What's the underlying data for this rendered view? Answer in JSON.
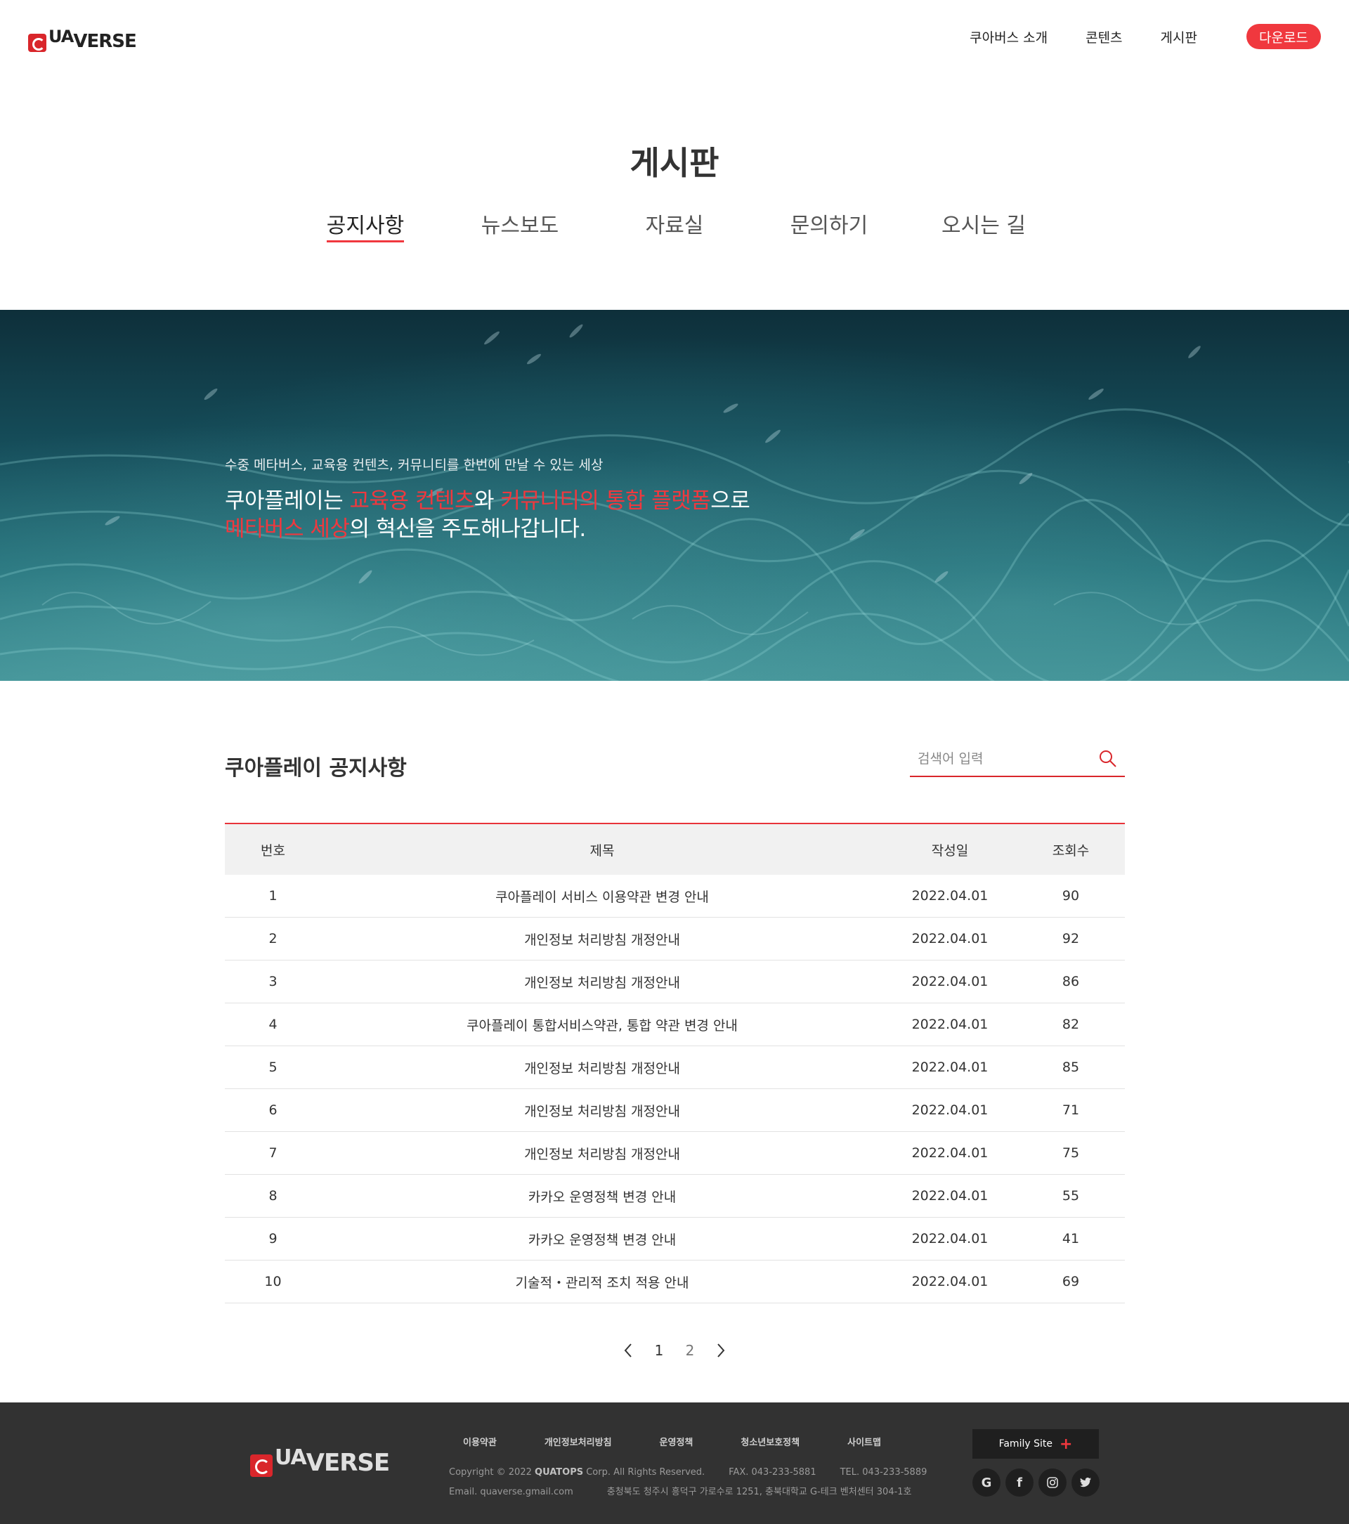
{
  "header": {
    "logo": "QUAVERSE",
    "nav": [
      "쿠아버스 소개",
      "콘텐츠",
      "게시판"
    ],
    "download_label": "다운로드"
  },
  "page": {
    "title": "게시판",
    "tabs": [
      "공지사항",
      "뉴스보도",
      "자료실",
      "문의하기",
      "오시는 길"
    ],
    "active_tab": "공지사항"
  },
  "hero": {
    "subtitle": "수중 메타버스, 교육용 컨텐츠, 커뮤니티를 한번에 만날 수 있는 세상",
    "line1": {
      "a": "쿠아플레이는 ",
      "b": "교육용 컨텐츠",
      "c": "와 ",
      "d": "커뮤니티의 통합 플랫폼",
      "e": "으로"
    },
    "line2": {
      "a": "메타버스 세상",
      "b": "의 혁신을 주도해나갑니다."
    }
  },
  "board": {
    "title": "쿠아플레이 공지사항",
    "search_placeholder": "검색어 입력",
    "columns": {
      "num": "번호",
      "title": "제목",
      "date": "작성일",
      "views": "조회수"
    },
    "rows": [
      {
        "num": "1",
        "title": "쿠아플레이 서비스 이용약관 변경 안내",
        "date": "2022.04.01",
        "views": "90"
      },
      {
        "num": "2",
        "title": "개인정보 처리방침 개정안내",
        "date": "2022.04.01",
        "views": "92"
      },
      {
        "num": "3",
        "title": "개인정보 처리방침 개정안내",
        "date": "2022.04.01",
        "views": "86"
      },
      {
        "num": "4",
        "title": "쿠아플레이 통합서비스약관, 통합 약관 변경 안내",
        "date": "2022.04.01",
        "views": "82"
      },
      {
        "num": "5",
        "title": "개인정보 처리방침 개정안내",
        "date": "2022.04.01",
        "views": "85"
      },
      {
        "num": "6",
        "title": "개인정보 처리방침 개정안내",
        "date": "2022.04.01",
        "views": "71"
      },
      {
        "num": "7",
        "title": "개인정보 처리방침 개정안내",
        "date": "2022.04.01",
        "views": "75"
      },
      {
        "num": "8",
        "title": "카카오 운영정책 변경 안내",
        "date": "2022.04.01",
        "views": "55"
      },
      {
        "num": "9",
        "title": "카카오 운영정책 변경 안내",
        "date": "2022.04.01",
        "views": "41"
      },
      {
        "num": "10",
        "title": "기술적・관리적 조치 적용 안내",
        "date": "2022.04.01",
        "views": "69"
      }
    ]
  },
  "pagination": {
    "pages": [
      "1",
      "2"
    ],
    "current": "1"
  },
  "footer": {
    "logo": "QUAVERSE",
    "links": [
      "이용약관",
      "개인정보처리방침",
      "운영정책",
      "청소년보호정책",
      "사이트맵"
    ],
    "copyright_pre": "Copyright © 2022 ",
    "company": "QUATOPS",
    "copyright_post": " Corp. All Rights Reserved.",
    "fax": "FAX. 043-233-5881",
    "tel": "TEL. 043-233-5889",
    "email": "Email. quaverse.gmail.com",
    "address": "충청북도 청주시 흥덕구 가로수로 1251, 충북대학교 G-테크 벤처센터 304-1호",
    "family_site": "Family Site",
    "socials": [
      "google-icon",
      "facebook-icon",
      "instagram-icon",
      "twitter-icon"
    ]
  },
  "colors": {
    "accent": "#f0383e",
    "footer_bg": "#323232",
    "header_bg": "#f1f1f1"
  }
}
